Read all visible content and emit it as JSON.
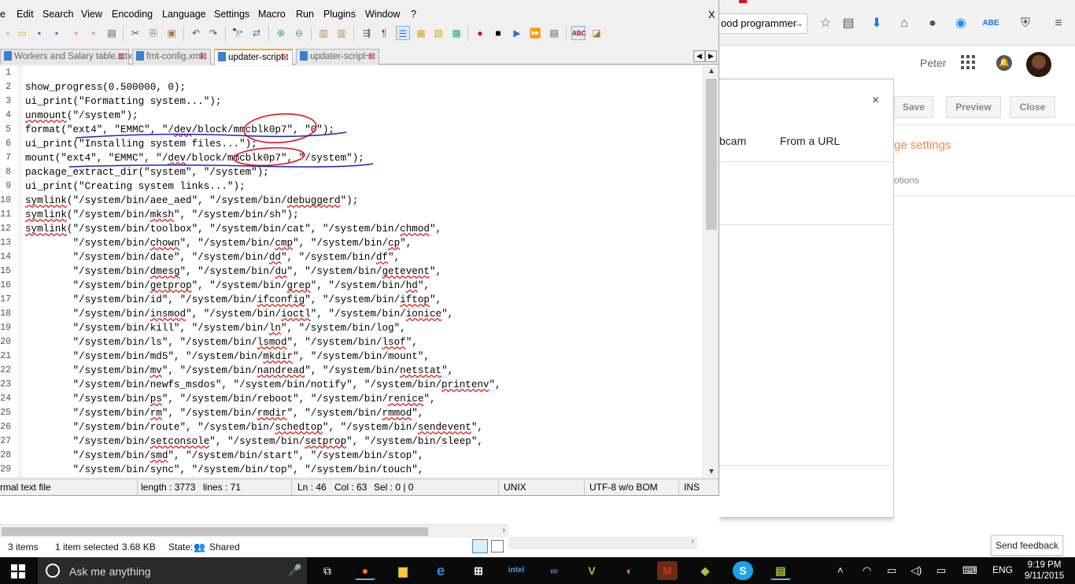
{
  "npp": {
    "menus": [
      "e",
      "Edit",
      "Search",
      "View",
      "Encoding",
      "Language",
      "Settings",
      "Macro",
      "Run",
      "Plugins",
      "Window",
      "?"
    ],
    "close_x": "X",
    "tabs": [
      "Workers and Salary table.c.txt",
      "fmt-config.xml",
      "updater-script",
      "updater-script~"
    ],
    "active_tab": 2,
    "lines": [
      {
        "n": "1",
        "t": ""
      },
      {
        "n": "2",
        "t": "show_progress(0.500000, 0);"
      },
      {
        "n": "3",
        "t": "ui_print(\"Formatting system...\");"
      },
      {
        "n": "4",
        "t": "unmount(\"/system\");"
      },
      {
        "n": "5",
        "t": "format(\"ext4\", \"EMMC\", \"/dev/block/mmcblk0p7\", \"0\");"
      },
      {
        "n": "6",
        "t": "ui_print(\"Installing system files...\");"
      },
      {
        "n": "7",
        "t": "mount(\"ext4\", \"EMMC\", \"/dev/block/mmcblk0p7\", \"/system\");"
      },
      {
        "n": "8",
        "t": "package_extract_dir(\"system\", \"/system\");"
      },
      {
        "n": "9",
        "t": "ui_print(\"Creating system links...\");"
      },
      {
        "n": "10",
        "t": "symlink(\"/system/bin/aee_aed\", \"/system/bin/debuggerd\");"
      },
      {
        "n": "11",
        "t": "symlink(\"/system/bin/mksh\", \"/system/bin/sh\");"
      },
      {
        "n": "12",
        "t": "symlink(\"/system/bin/toolbox\", \"/system/bin/cat\", \"/system/bin/chmod\","
      },
      {
        "n": "13",
        "t": "        \"/system/bin/chown\", \"/system/bin/cmp\", \"/system/bin/cp\","
      },
      {
        "n": "14",
        "t": "        \"/system/bin/date\", \"/system/bin/dd\", \"/system/bin/df\","
      },
      {
        "n": "15",
        "t": "        \"/system/bin/dmesg\", \"/system/bin/du\", \"/system/bin/getevent\","
      },
      {
        "n": "16",
        "t": "        \"/system/bin/getprop\", \"/system/bin/grep\", \"/system/bin/hd\","
      },
      {
        "n": "17",
        "t": "        \"/system/bin/id\", \"/system/bin/ifconfig\", \"/system/bin/iftop\","
      },
      {
        "n": "18",
        "t": "        \"/system/bin/insmod\", \"/system/bin/ioctl\", \"/system/bin/ionice\","
      },
      {
        "n": "19",
        "t": "        \"/system/bin/kill\", \"/system/bin/ln\", \"/system/bin/log\","
      },
      {
        "n": "20",
        "t": "        \"/system/bin/ls\", \"/system/bin/lsmod\", \"/system/bin/lsof\","
      },
      {
        "n": "21",
        "t": "        \"/system/bin/md5\", \"/system/bin/mkdir\", \"/system/bin/mount\","
      },
      {
        "n": "22",
        "t": "        \"/system/bin/mv\", \"/system/bin/nandread\", \"/system/bin/netstat\","
      },
      {
        "n": "23",
        "t": "        \"/system/bin/newfs_msdos\", \"/system/bin/notify\", \"/system/bin/printenv\","
      },
      {
        "n": "24",
        "t": "        \"/system/bin/ps\", \"/system/bin/reboot\", \"/system/bin/renice\","
      },
      {
        "n": "25",
        "t": "        \"/system/bin/rm\", \"/system/bin/rmdir\", \"/system/bin/rmmod\","
      },
      {
        "n": "26",
        "t": "        \"/system/bin/route\", \"/system/bin/schedtop\", \"/system/bin/sendevent\","
      },
      {
        "n": "27",
        "t": "        \"/system/bin/setconsole\", \"/system/bin/setprop\", \"/system/bin/sleep\","
      },
      {
        "n": "28",
        "t": "        \"/system/bin/smd\", \"/system/bin/start\", \"/system/bin/stop\","
      },
      {
        "n": "29",
        "t": "        \"/system/bin/sync\", \"/system/bin/top\", \"/system/bin/touch\","
      }
    ],
    "spell_words": [
      "unmount",
      "symlink",
      "debuggerd",
      "mksh",
      "chmod",
      "chown",
      "cmp",
      "cp",
      "dd",
      "df",
      "dmesg",
      "du",
      "getevent",
      "getprop",
      "grep",
      "hd",
      "ifconfig",
      "iftop",
      "insmod",
      "ioctl",
      "ionice",
      "ln",
      "lsmod",
      "lsof",
      "mkdir",
      "mv",
      "nandread",
      "netstat",
      "printenv",
      "ps",
      "renice",
      "rm",
      "rmdir",
      "rmmod",
      "schedtop",
      "sendevent",
      "setconsole",
      "setprop",
      "smd",
      "dev"
    ],
    "status": {
      "type": "rmal text file",
      "length": "length : 3773",
      "lines": "lines : 71",
      "ln": "Ln : 46",
      "col": "Col : 63",
      "sel": "Sel : 0 | 0",
      "eol": "UNIX",
      "encoding": "UTF-8 w/o BOM",
      "mode": "INS"
    }
  },
  "chrome": {
    "omnibox": "ood programmer",
    "omnibox_arrow": "→",
    "user": "Peter",
    "notif_count": "",
    "dialog": {
      "close": "×",
      "tab_webcam": "bcam",
      "tab_url": "From a URL"
    },
    "buttons": {
      "save": "Save",
      "preview": "Preview",
      "close": "Close"
    },
    "settings_title": "ge settings",
    "options_label": "otions",
    "feedback": "Send feedback"
  },
  "explorer": {
    "items": "3 items",
    "selected": "1 item selected",
    "size": "3.68 KB",
    "state_label": "State:",
    "state_value": "Shared"
  },
  "taskbar": {
    "search_placeholder": "Ask me anything",
    "language": "ENG",
    "time": "9:19 PM",
    "date": "9/11/2015"
  },
  "colors": {
    "annotation_red": "#e5121e",
    "annotation_blue": "#1e22c9",
    "active_tab_accent": "#f7a53d",
    "blogger_orange": "#f0884a"
  }
}
